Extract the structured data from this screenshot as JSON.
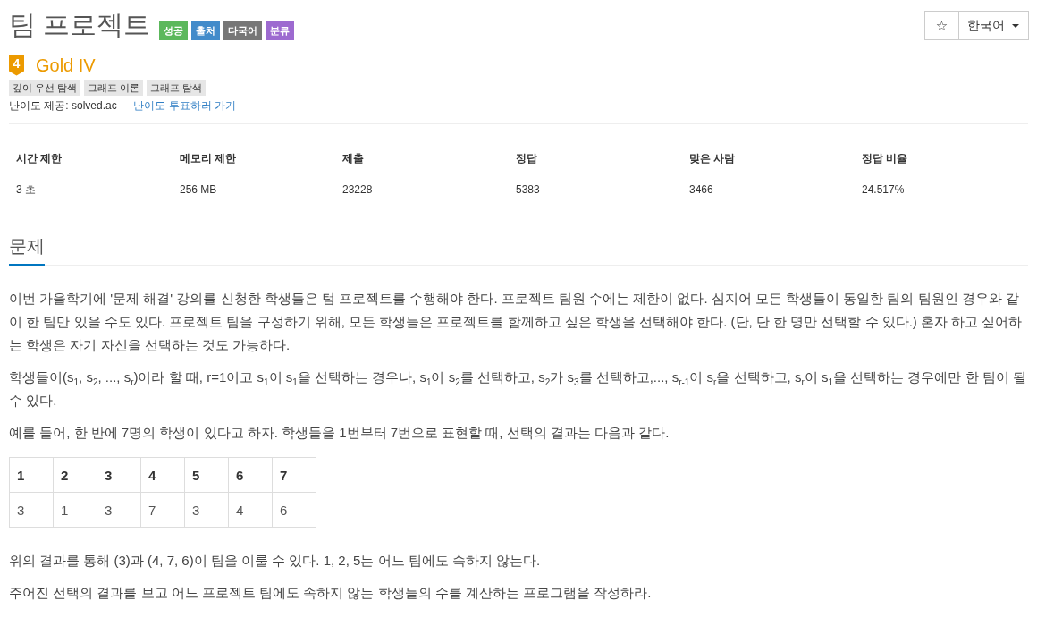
{
  "title": "팀 프로젝트",
  "labels": [
    {
      "text": "성공",
      "color": "#5cb85c"
    },
    {
      "text": "출처",
      "color": "#428bca"
    },
    {
      "text": "다국어",
      "color": "#777777"
    },
    {
      "text": "분류",
      "color": "#9d6ad0"
    }
  ],
  "actions": {
    "star": "☆",
    "language": "한국어"
  },
  "tier": {
    "number": "4",
    "name": "Gold IV"
  },
  "tags": [
    "깊이 우선 탐색",
    "그래프 이론",
    "그래프 탐색"
  ],
  "difficulty_source": {
    "text": "난이도 제공: solved.ac —",
    "link": "난이도 투표하러 가기"
  },
  "info_table": {
    "columns": [
      "시간 제한",
      "메모리 제한",
      "제출",
      "정답",
      "맞은 사람",
      "정답 비율"
    ],
    "rows": [
      [
        "3 초",
        "256 MB",
        "23228",
        "5383",
        "3466",
        "24.517%"
      ]
    ]
  },
  "problem": {
    "title": "문제",
    "paragraphs_before": [
      "이번 가을학기에 '문제 해결' 강의를 신청한 학생들은 텀 프로젝트를 수행해야 한다. 프로젝트 팀원 수에는 제한이 없다. 심지어 모든 학생들이 동일한 팀의 팀원인 경우와 같이 한 팀만 있을 수도 있다. 프로젝트 팀을 구성하기 위해, 모든 학생들은 프로젝트를 함께하고 싶은 학생을 선택해야 한다. (단, 단 한 명만 선택할 수 있다.) 혼자 하고 싶어하는 학생은 자기 자신을 선택하는 것도 가능하다.",
      "학생들이(s$_{1}$, s$_{2}$, ..., s$_{r}$)이라 할 때, r=1이고 s$_{1}$이 s$_{1}$을 선택하는 경우나, s$_{1}$이 s$_{2}$를 선택하고, s$_{2}$가 s$_{3}$를 선택하고,..., s$_{r-1}$이 s$_{r}$을 선택하고, s$_{r}$이 s$_{1}$을 선택하는 경우에만 한 팀이 될 수 있다.",
      "예를 들어, 한 반에 7명의 학생이 있다고 하자. 학생들을 1번부터 7번으로 표현할 때, 선택의 결과는 다음과 같다."
    ],
    "table": {
      "columns": [
        "1",
        "2",
        "3",
        "4",
        "5",
        "6",
        "7"
      ],
      "rows": [
        [
          "3",
          "1",
          "3",
          "7",
          "3",
          "4",
          "6"
        ]
      ]
    },
    "paragraphs_after": [
      "위의 결과를 통해 (3)과 (4, 7, 6)이 팀을 이룰 수 있다. 1, 2, 5는 어느 팀에도 속하지 않는다.",
      "주어진 선택의 결과를 보고 어느 프로젝트 팀에도 속하지 않는 학생들의 수를 계산하는 프로그램을 작성하라."
    ]
  }
}
